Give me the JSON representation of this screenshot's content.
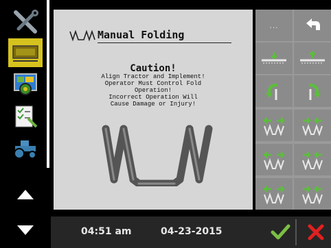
{
  "sidebar": {
    "items": [
      {
        "icon": "tools-icon"
      },
      {
        "icon": "implement-icon",
        "selected": true
      },
      {
        "icon": "display-settings-icon"
      },
      {
        "icon": "checklist-icon"
      },
      {
        "icon": "tractor-icon"
      },
      {
        "icon": "scroll-up-icon"
      },
      {
        "icon": "scroll-down-icon"
      }
    ]
  },
  "panel": {
    "title": "Manual Folding",
    "caution_title": "Caution!",
    "caution_lines": [
      "Align Tractor and Implement!",
      "Operator Must Control Fold",
      "Operation!",
      "Incorrect Operation Will",
      "Cause Damage or Injury!"
    ]
  },
  "grid": {
    "more_label": "...",
    "buttons": [
      "more-button",
      "back-button",
      "fold-down-button",
      "fold-up-button",
      "rotate-left-button",
      "rotate-right-button",
      "wing-fold-in-button-1",
      "wing-fold-out-button-1",
      "wing-fold-in-button-2",
      "wing-fold-out-button-2",
      "wing-fold-in-button-3",
      "wing-fold-out-button-3"
    ]
  },
  "status": {
    "time": "04:51 am",
    "date": "04-23-2015"
  },
  "colors": {
    "selected": "#d6c21e",
    "ok": "#7bc043",
    "cancel": "#e02020"
  }
}
